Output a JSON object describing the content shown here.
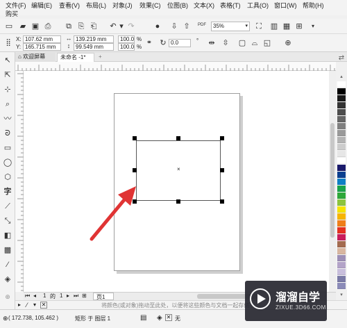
{
  "menubar": {
    "items": [
      "文件(F)",
      "编辑(E)",
      "查看(V)",
      "布局(L)",
      "对象(J)",
      "效果(C)",
      "位图(B)",
      "文本(X)",
      "表格(T)",
      "工具(O)",
      "窗口(W)",
      "帮助(H)"
    ],
    "buy": "购买"
  },
  "toolbar": {
    "zoom_value": "35%",
    "pdf_label": "PDF"
  },
  "property_bar": {
    "x_label": "X:",
    "x_value": "107.62 mm",
    "y_label": "Y:",
    "y_value": "165.715 mm",
    "width_value": "139.219 mm",
    "height_value": "99.549 mm",
    "scale_w": "100.0",
    "scale_h": "100.0",
    "percent": "%",
    "rotation_value": "0.0",
    "degree": "°"
  },
  "tabs": {
    "welcome": "欢迎屏幕",
    "document": "未命名 -1*",
    "add": "+"
  },
  "page_nav": {
    "current": "1",
    "of_label": "的",
    "total": "1",
    "page_tab": "页1"
  },
  "hint": "将颜色(或对象)拖动至此处，以便将这些颜色与文档一起存储",
  "status": {
    "coords": "( 172.738, 105.462 )",
    "object_info": "矩形 于 图层 1",
    "fill_none": "无"
  },
  "watermark": {
    "title": "溜溜自学",
    "url": "ZIXUE.3D66.COM"
  },
  "palette": [
    "#ffffff",
    "#000000",
    "#1a1a1a",
    "#333333",
    "#4d4d4d",
    "#666666",
    "#808080",
    "#999999",
    "#b3b3b3",
    "#cccccc",
    "#e6e6e6",
    "#ffffff",
    "#1b1b6b",
    "#0b3f8f",
    "#0f7fc5",
    "#1ba34a",
    "#2ea83a",
    "#8cc43f",
    "#f5e400",
    "#f7b500",
    "#ef7f1a",
    "#e43121",
    "#c91d5b",
    "#a36b4f",
    "#d8b6a0",
    "#9d8fb6",
    "#b3a3c8",
    "#c8bedc",
    "#7a7aa6",
    "#8b8bb8"
  ],
  "colors": {
    "arrow": "#e03434",
    "accent": "#0f7fc5"
  }
}
